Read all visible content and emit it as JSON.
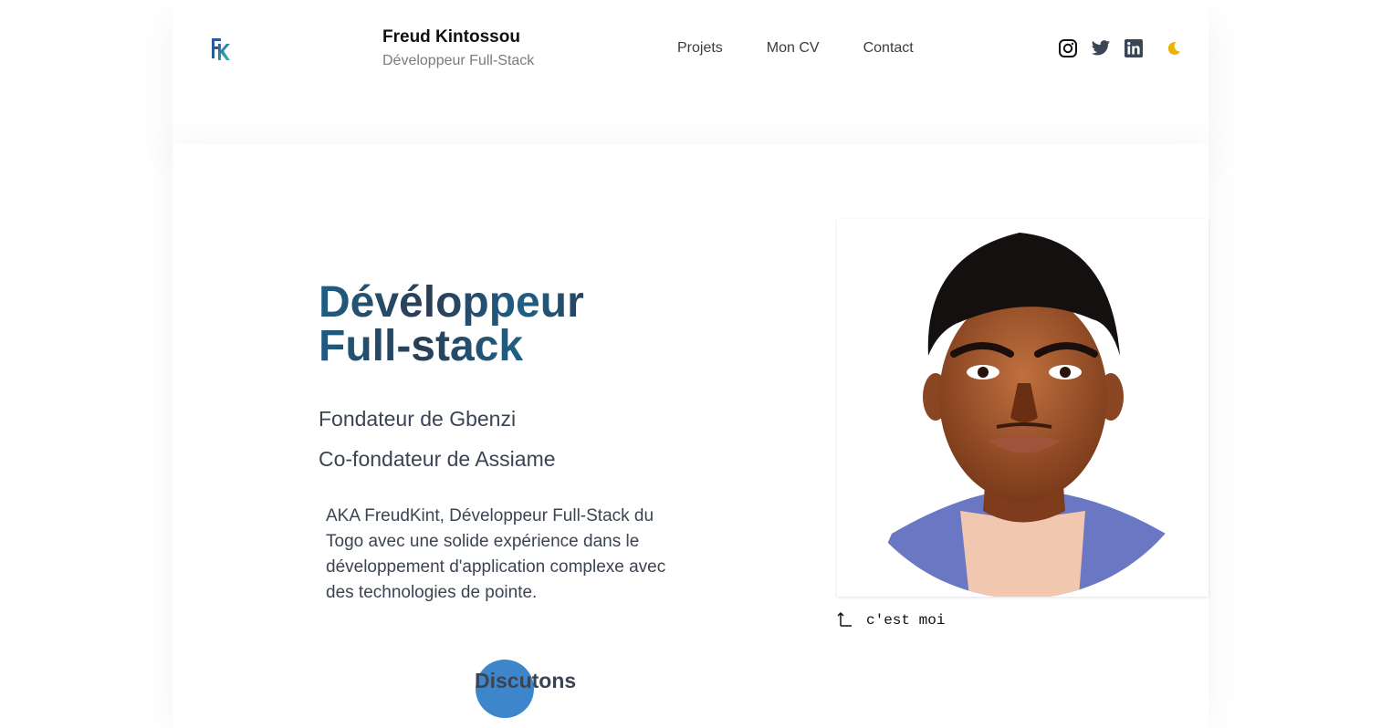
{
  "header": {
    "logo_text": "FK",
    "brand_name": "Freud Kintossou",
    "brand_subtitle": "Développeur Full-Stack",
    "nav": [
      "Projets",
      "Mon CV",
      "Contact"
    ],
    "social_icons": [
      "instagram-icon",
      "twitter-icon",
      "linkedin-icon"
    ],
    "theme_toggle_icon": "moon-icon"
  },
  "hero": {
    "title_line1": "Dévéloppeur",
    "title_line2": "Full-stack",
    "role1": "Fondateur de Gbenzi",
    "role2": "Co-fondateur de Assiame",
    "description": "AKA FreudKint, Développeur Full-Stack du Togo avec une solide expérience dans  le développement d'application complexe avec des technologies de pointe.",
    "cta_label": "Discutons",
    "photo_caption": "c'est moi"
  },
  "colors": {
    "accent_blue": "#3e86cc",
    "title_gradient_start": "#1f5f86",
    "title_gradient_end": "#2a3d55",
    "moon_yellow": "#eab308"
  }
}
